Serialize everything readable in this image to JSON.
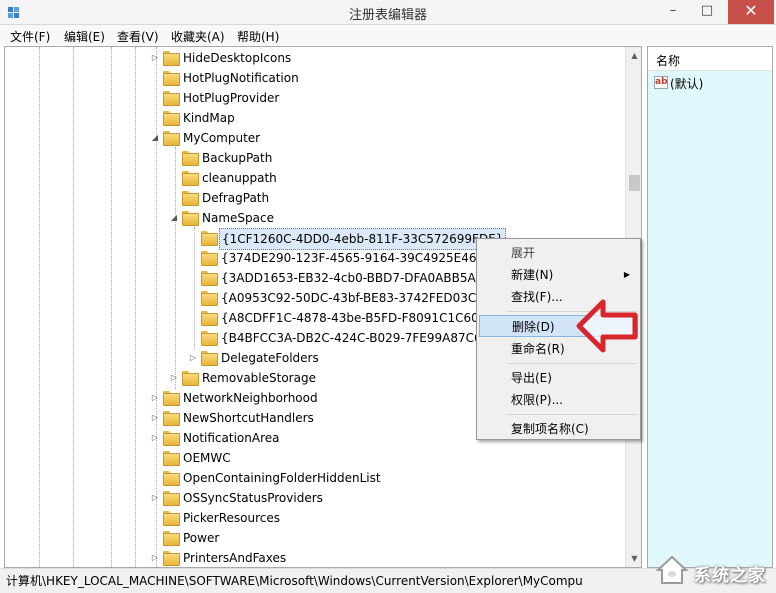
{
  "window": {
    "title": "注册表编辑器",
    "controls": {
      "minimize": "–",
      "maximize": "□",
      "close": "✕"
    }
  },
  "menubar": [
    "文件(F)",
    "编辑(E)",
    "查看(V)",
    "收藏夹(A)",
    "帮助(H)"
  ],
  "tree": [
    {
      "label": "HideDesktopIcons",
      "level": 0,
      "expander": "collapsed"
    },
    {
      "label": "HotPlugNotification",
      "level": 0,
      "expander": "none"
    },
    {
      "label": "HotPlugProvider",
      "level": 0,
      "expander": "none"
    },
    {
      "label": "KindMap",
      "level": 0,
      "expander": "none"
    },
    {
      "label": "MyComputer",
      "level": 0,
      "expander": "expanded"
    },
    {
      "label": "BackupPath",
      "level": 1,
      "expander": "none"
    },
    {
      "label": "cleanuppath",
      "level": 1,
      "expander": "none"
    },
    {
      "label": "DefragPath",
      "level": 1,
      "expander": "none"
    },
    {
      "label": "NameSpace",
      "level": 1,
      "expander": "expanded"
    },
    {
      "label": "{1CF1260C-4DD0-4ebb-811F-33C572699FDE}",
      "level": 2,
      "expander": "none",
      "selected": true
    },
    {
      "label": "{374DE290-123F-4565-9164-39C4925E467B}",
      "level": 2,
      "expander": "none"
    },
    {
      "label": "{3ADD1653-EB32-4cb0-BBD7-DFA0ABB5ACCA}",
      "level": 2,
      "expander": "none"
    },
    {
      "label": "{A0953C92-50DC-43bf-BE83-3742FED03C9C}",
      "level": 2,
      "expander": "none"
    },
    {
      "label": "{A8CDFF1C-4878-43be-B5FD-F8091C1C60D0}",
      "level": 2,
      "expander": "none"
    },
    {
      "label": "{B4BFCC3A-DB2C-424C-B029-7FE99A87C641}",
      "level": 2,
      "expander": "none"
    },
    {
      "label": "DelegateFolders",
      "level": 2,
      "expander": "collapsed"
    },
    {
      "label": "RemovableStorage",
      "level": 1,
      "expander": "collapsed"
    },
    {
      "label": "NetworkNeighborhood",
      "level": 0,
      "expander": "collapsed"
    },
    {
      "label": "NewShortcutHandlers",
      "level": 0,
      "expander": "collapsed"
    },
    {
      "label": "NotificationArea",
      "level": 0,
      "expander": "collapsed"
    },
    {
      "label": "OEMWC",
      "level": 0,
      "expander": "none"
    },
    {
      "label": "OpenContainingFolderHiddenList",
      "level": 0,
      "expander": "none"
    },
    {
      "label": "OSSyncStatusProviders",
      "level": 0,
      "expander": "collapsed"
    },
    {
      "label": "PickerResources",
      "level": 0,
      "expander": "none"
    },
    {
      "label": "Power",
      "level": 0,
      "expander": "none"
    },
    {
      "label": "PrintersAndFaxes",
      "level": 0,
      "expander": "collapsed"
    }
  ],
  "value_pane": {
    "column_header": "名称",
    "icon_text": "ab",
    "default_entry": "(默认)"
  },
  "context_menu": [
    {
      "label": "展开",
      "type": "item",
      "state": "disabled"
    },
    {
      "label": "新建(N)",
      "type": "item",
      "submenu": true,
      "arrow": "▶"
    },
    {
      "label": "查找(F)...",
      "type": "item"
    },
    {
      "type": "separator"
    },
    {
      "label": "删除(D)",
      "type": "item",
      "state": "highlighted"
    },
    {
      "label": "重命名(R)",
      "type": "item"
    },
    {
      "type": "separator"
    },
    {
      "label": "导出(E)",
      "type": "item"
    },
    {
      "label": "权限(P)...",
      "type": "item"
    },
    {
      "type": "separator"
    },
    {
      "label": "复制项名称(C)",
      "type": "item"
    }
  ],
  "statusbar": {
    "path": "计算机\\HKEY_LOCAL_MACHINE\\SOFTWARE\\Microsoft\\Windows\\CurrentVersion\\Explorer\\MyCompu"
  },
  "watermark": {
    "text": "系统之家"
  },
  "colors": {
    "context_highlight": "#d2e4f8",
    "annotation_arrow": "#d9262c",
    "value_pane_bg": "#e0f8fb",
    "close_button": "#c7504a"
  },
  "icons": {
    "app": "regedit-icon",
    "folder": "folder-icon",
    "string_value": "string-value-icon",
    "annotation": "red-arrow-icon"
  }
}
